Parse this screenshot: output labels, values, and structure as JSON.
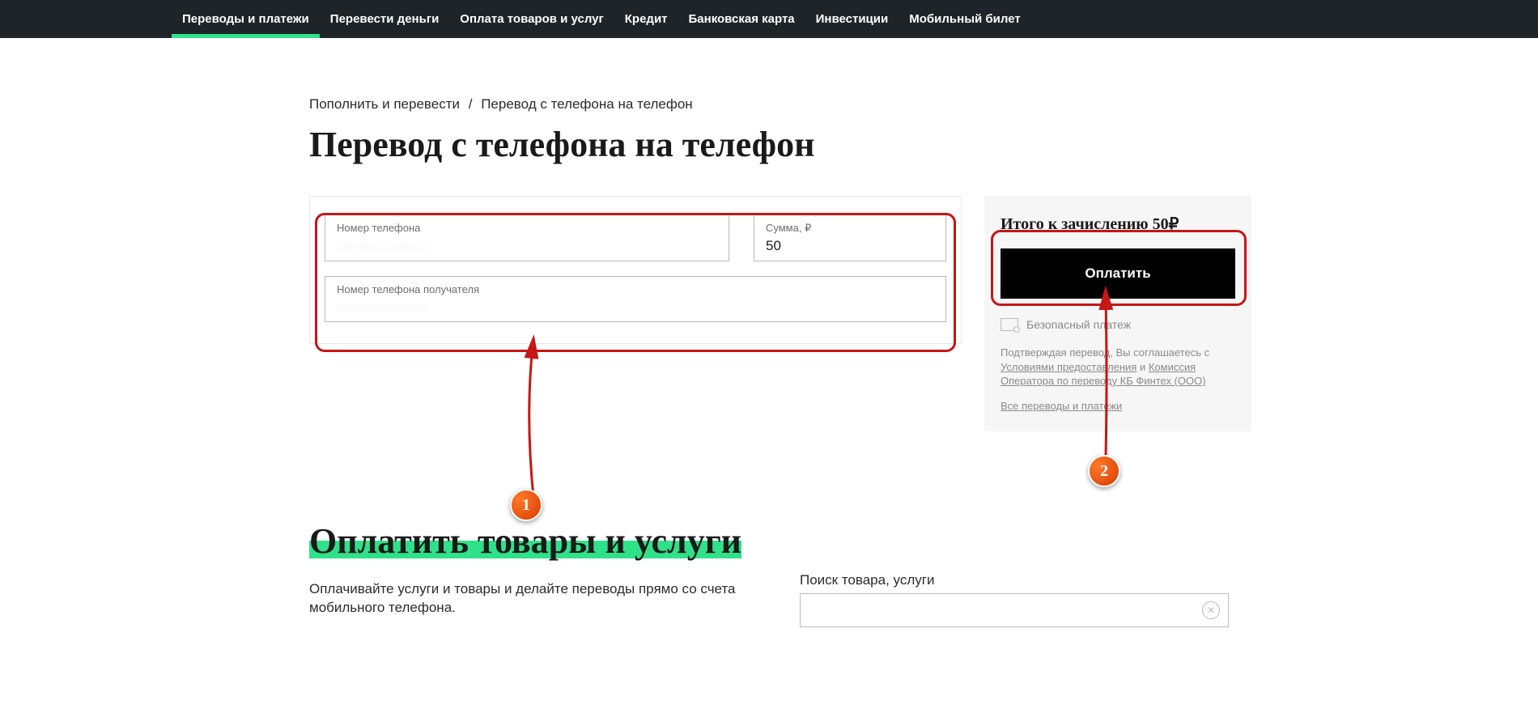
{
  "nav": {
    "items": [
      {
        "label": "Переводы и платежи",
        "active": true
      },
      {
        "label": "Перевести деньги"
      },
      {
        "label": "Оплата товаров и услуг"
      },
      {
        "label": "Кредит"
      },
      {
        "label": "Банковская карта"
      },
      {
        "label": "Инвестиции"
      },
      {
        "label": "Мобильный билет"
      }
    ]
  },
  "breadcrumb": {
    "parent": "Пополнить и перевести",
    "current": "Перевод с телефона на телефон"
  },
  "page": {
    "title": "Перевод с телефона на телефон"
  },
  "form": {
    "phone_label": "Номер телефона",
    "phone_value": "· · · · · · · · · · ·",
    "amount_label": "Сумма, ₽",
    "amount_value": "50",
    "recipient_label": "Номер телефона получателя",
    "recipient_value": "· · · · · · · · · · ·"
  },
  "summary": {
    "total_label": "Итого к зачислению",
    "total_value": "50₽",
    "pay_button": "Оплатить",
    "secure_label": "Безопасный платеж",
    "disclaimer_prefix": "Подтверждая перевод, Вы соглашаетесь с ",
    "terms_link": "Условиями предоставления",
    "disclaimer_mid": " и ",
    "commission_link": "Комиссия Оператора по переводу КБ Финтех (ООО)",
    "all_link": "Все переводы и платежи"
  },
  "section2": {
    "title": "Оплатить товары и услуги",
    "desc": "Оплачивайте услуги и товары и делайте переводы прямо со счета мобильного телефона.",
    "search_label": "Поиск товара, услуги",
    "search_placeholder": ""
  },
  "markers": {
    "m1": "1",
    "m2": "2"
  }
}
